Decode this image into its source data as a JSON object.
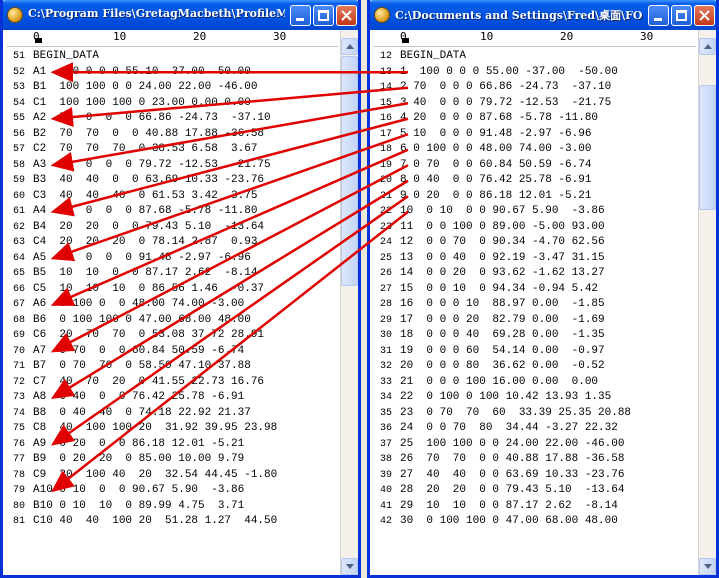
{
  "left_window": {
    "title": "C:\\Program Files\\GretagMacbeth\\ProfileMak...",
    "ruler_labels": [
      "0",
      "10",
      "20",
      "30"
    ],
    "lines": [
      {
        "num": "51",
        "text": "BEGIN_DATA"
      },
      {
        "num": "52",
        "text": "A1  100 0 0 0 55.10  37.00  50.00"
      },
      {
        "num": "53",
        "text": "B1  100 100 0 0 24.00 22.00 -46.00"
      },
      {
        "num": "54",
        "text": "C1  100 100 100 0 23.00 0.00 0.00"
      },
      {
        "num": "55",
        "text": "A2  70  0  0  0 66.86 -24.73  -37.10"
      },
      {
        "num": "56",
        "text": "B2  70  70  0  0 40.88 17.88 -36.58"
      },
      {
        "num": "57",
        "text": "C2  70  70  70  0 38.53 6.58  3.67"
      },
      {
        "num": "58",
        "text": "A3  40  0  0  0 79.72 -12.53  -21.75"
      },
      {
        "num": "59",
        "text": "B3  40  40  0  0 63.69 10.33 -23.76"
      },
      {
        "num": "60",
        "text": "C3  40  40  40  0 61.53 3.42  3.75"
      },
      {
        "num": "61",
        "text": "A4  20  0  0  0 87.68 -5.78 -11.80"
      },
      {
        "num": "62",
        "text": "B4  20  20  0  0 79.43 5.10  -13.64"
      },
      {
        "num": "63",
        "text": "C4  20  20  20  0 78.14 2.87  0.93"
      },
      {
        "num": "64",
        "text": "A5  10  0  0  0 91.48 -2.97 -6.96"
      },
      {
        "num": "65",
        "text": "B5  10  10  0  0 87.17 2.62  -8.14"
      },
      {
        "num": "66",
        "text": "C5  10  10  10  0 86.56 1.46  -0.37"
      },
      {
        "num": "67",
        "text": "A6  0 100 0  0 48.00 74.00 -3.00"
      },
      {
        "num": "68",
        "text": "B6  0 100 100 0 47.00 68.00 48.00"
      },
      {
        "num": "69",
        "text": "C6  20  70  70  0 53.08 37.72 28.91"
      },
      {
        "num": "70",
        "text": "A7  0 70  0  0 60.84 50.59 -6.74"
      },
      {
        "num": "71",
        "text": "B7  0 70  70  0 58.50 47.10 37.88"
      },
      {
        "num": "72",
        "text": "C7  40  70  20  0 41.55 22.73 16.76"
      },
      {
        "num": "73",
        "text": "A8  0 40  0  0 76.42 25.78 -6.91"
      },
      {
        "num": "74",
        "text": "B8  0 40  40  0 74.18 22.92 21.37"
      },
      {
        "num": "75",
        "text": "C8  40  100 100 20  31.92 39.95 23.98"
      },
      {
        "num": "76",
        "text": "A9  0 20  0  0 86.18 12.01 -5.21"
      },
      {
        "num": "77",
        "text": "B9  0 20  20  0 85.00 10.00 9.79"
      },
      {
        "num": "78",
        "text": "C9  20  100 40  20  32.54 44.45 -1.80"
      },
      {
        "num": "79",
        "text": "A10 0 10  0  0 90.67 5.90  -3.86"
      },
      {
        "num": "80",
        "text": "B10 0 10  10  0 89.99 4.75  3.71"
      },
      {
        "num": "81",
        "text": "C10 40  40  100 20  51.28 1.27  44.50"
      }
    ]
  },
  "right_window": {
    "title": "C:\\Documents and Settings\\Fred\\桌面\\FOG...",
    "ruler_labels": [
      "0",
      "10",
      "20",
      "30"
    ],
    "lines": [
      {
        "num": "12",
        "text": "BEGIN_DATA"
      },
      {
        "num": "13",
        "text": "1  100 0 0 0 55.00 -37.00  -50.00"
      },
      {
        "num": "14",
        "text": "2 70  0 0 0 66.86 -24.73  -37.10"
      },
      {
        "num": "15",
        "text": "3 40  0 0 0 79.72 -12.53  -21.75"
      },
      {
        "num": "16",
        "text": "4 20  0 0 0 87.68 -5.78 -11.80"
      },
      {
        "num": "17",
        "text": "5 10  0 0 0 91.48 -2.97 -6.96"
      },
      {
        "num": "18",
        "text": "6 0 100 0 0 48.00 74.00 -3.00"
      },
      {
        "num": "19",
        "text": "7 0 70  0 0 60.84 50.59 -6.74"
      },
      {
        "num": "20",
        "text": "8 0 40  0 0 76.42 25.78 -6.91"
      },
      {
        "num": "21",
        "text": "9 0 20  0 0 86.18 12.01 -5.21"
      },
      {
        "num": "22",
        "text": "10  0 10  0 0 90.67 5.90  -3.86"
      },
      {
        "num": "23",
        "text": "11  0 0 100 0 89.00 -5.00 93.00"
      },
      {
        "num": "24",
        "text": "12  0 0 70  0 90.34 -4.70 62.56"
      },
      {
        "num": "25",
        "text": "13  0 0 40  0 92.19 -3.47 31.15"
      },
      {
        "num": "26",
        "text": "14  0 0 20  0 93.62 -1.62 13.27"
      },
      {
        "num": "27",
        "text": "15  0 0 10  0 94.34 -0.94 5.42"
      },
      {
        "num": "28",
        "text": "16  0 0 0 10  88.97 0.00  -1.85"
      },
      {
        "num": "29",
        "text": "17  0 0 0 20  82.79 0.00  -1.69"
      },
      {
        "num": "30",
        "text": "18  0 0 0 40  69.28 0.00  -1.35"
      },
      {
        "num": "31",
        "text": "19  0 0 0 60  54.14 0.00  -0.97"
      },
      {
        "num": "32",
        "text": "20  0 0 0 80  36.62 0.00  -0.52"
      },
      {
        "num": "33",
        "text": "21  0 0 0 100 16.00 0.00  0.00"
      },
      {
        "num": "34",
        "text": "22  0 100 0 100 10.42 13.93 1.35"
      },
      {
        "num": "35",
        "text": "23  0 70  70  60  33.39 25.35 20.88"
      },
      {
        "num": "36",
        "text": "24  0 0 70  80  34.44 -3.27 22.32"
      },
      {
        "num": "37",
        "text": "25  100 100 0 0 24.00 22.00 -46.00"
      },
      {
        "num": "38",
        "text": "26  70  70  0 0 40.88 17.88 -36.58"
      },
      {
        "num": "39",
        "text": "27  40  40  0 0 63.69 10.33 -23.76"
      },
      {
        "num": "40",
        "text": "28  20  20  0 0 79.43 5.10  -13.64"
      },
      {
        "num": "41",
        "text": "29  10  10  0 0 87.17 2.62  -8.14"
      },
      {
        "num": "42",
        "text": "30  0 100 100 0 47.00 68.00 48.00"
      }
    ]
  },
  "annotation": {
    "arrow_color": "#e00000",
    "arrows": [
      {
        "from_right_line": "13",
        "to_left_line": "52"
      },
      {
        "from_right_line": "14",
        "to_left_line": "55"
      },
      {
        "from_right_line": "15",
        "to_left_line": "58"
      },
      {
        "from_right_line": "16",
        "to_left_line": "61"
      },
      {
        "from_right_line": "17",
        "to_left_line": "64"
      },
      {
        "from_right_line": "18",
        "to_left_line": "67"
      },
      {
        "from_right_line": "19",
        "to_left_line": "70"
      },
      {
        "from_right_line": "20",
        "to_left_line": "73"
      },
      {
        "from_right_line": "21",
        "to_left_line": "76"
      },
      {
        "from_right_line": "22",
        "to_left_line": "79"
      }
    ]
  },
  "colors": {
    "title_bar": "#0054e3",
    "window_border": "#0831d9",
    "close_button": "#c0391a"
  }
}
